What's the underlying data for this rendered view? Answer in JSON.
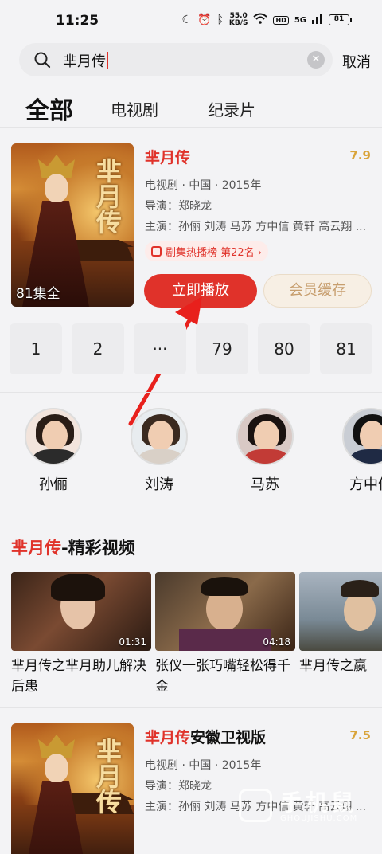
{
  "status_bar": {
    "time": "11:25",
    "net_speed_value": "55.0",
    "net_speed_unit": "KB/S",
    "hd": "HD",
    "signal": "5G",
    "battery": "81"
  },
  "search": {
    "query": "芈月传",
    "cancel_label": "取消"
  },
  "tabs": [
    {
      "label": "全部",
      "active": true
    },
    {
      "label": "电视剧",
      "active": false
    },
    {
      "label": "纪录片",
      "active": false
    }
  ],
  "result1": {
    "title": "芈月传",
    "title_suffix": "",
    "score": "7.9",
    "poster_text": "芈月传",
    "episodes_label": "81集全",
    "meta": "电视剧 · 中国 · 2015年",
    "director": "导演：郑晓龙",
    "cast": "主演：孙俪 刘涛 马苏 方中信 黄轩 高云翔 ...",
    "rank_label": "剧集热播榜 第22名 ›",
    "play_label": "立即播放",
    "vip_label": "会员缓存"
  },
  "episodes": [
    "1",
    "2",
    "···",
    "79",
    "80",
    "81"
  ],
  "cast_list": [
    {
      "name": "孙俪",
      "color": "#f2e4dc"
    },
    {
      "name": "刘涛",
      "color": "#e8ecef"
    },
    {
      "name": "马苏",
      "color": "#d9c9c5"
    },
    {
      "name": "方中信",
      "color": "#1f2a44"
    }
  ],
  "highlights": {
    "title_highlight": "芈月传",
    "title_rest": "-精彩视频",
    "videos": [
      {
        "title": "芈月传之芈月助儿解决后患",
        "duration": "01:31"
      },
      {
        "title": "张仪一张巧嘴轻松得千金",
        "duration": "04:18"
      },
      {
        "title": "芈月传之嬴",
        "duration": ""
      }
    ]
  },
  "result2": {
    "title": "芈月传",
    "title_suffix": "安徽卫视版",
    "score": "7.5",
    "poster_text": "芈月传",
    "meta": "电视剧 · 中国 · 2015年",
    "director": "导演：郑晓龙",
    "cast": "主演：孙俪 刘涛 马苏 方中信 黄轩 高云翔 ..."
  },
  "watermark": {
    "text": "手机鼠",
    "sub": "GHOUJISHU.COM"
  },
  "colors": {
    "accent": "#e0322a",
    "score": "#d9a43a",
    "vip": "#c79e6e"
  }
}
